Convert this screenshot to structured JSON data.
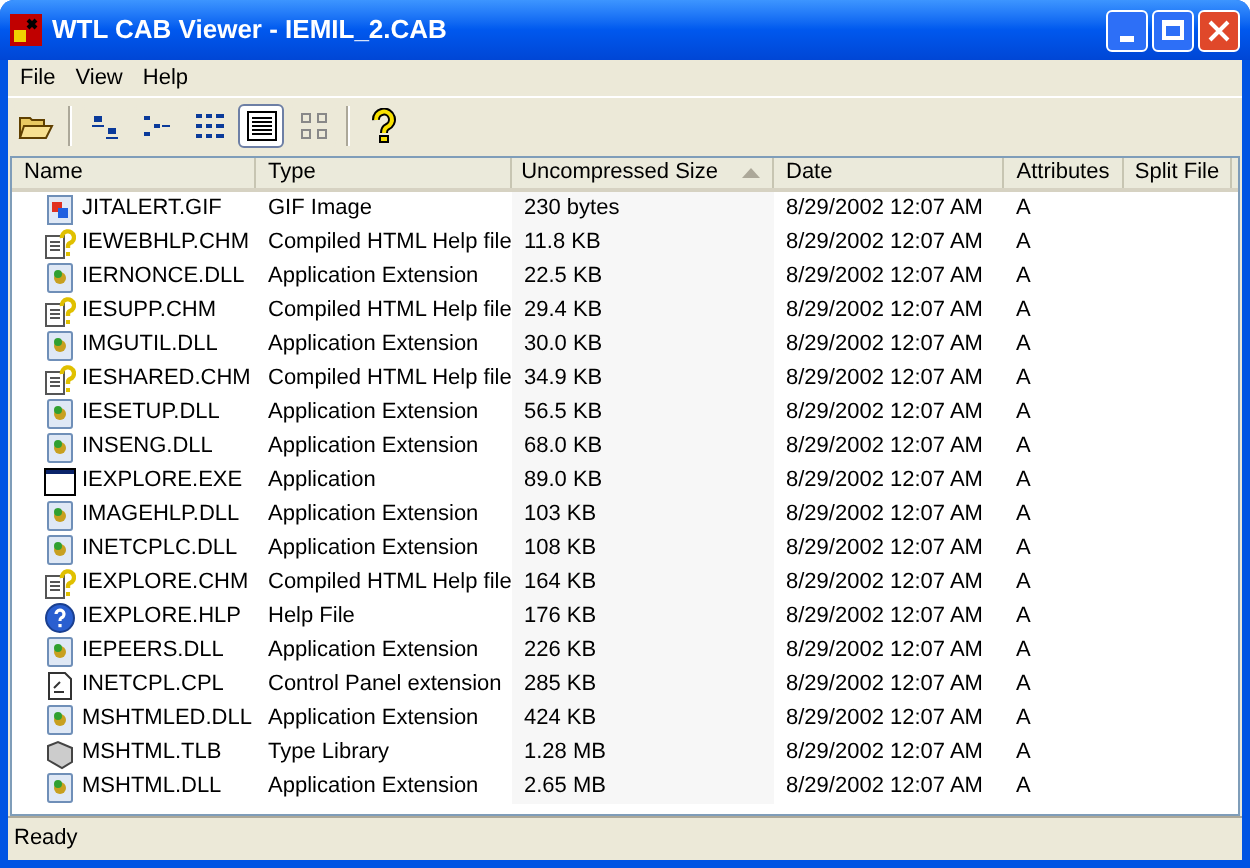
{
  "window": {
    "title": "WTL CAB Viewer - IEMIL_2.CAB"
  },
  "menu": [
    "File",
    "View",
    "Help"
  ],
  "toolbar": [
    {
      "kind": "open",
      "selected": false
    },
    {
      "kind": "sep"
    },
    {
      "kind": "large",
      "selected": false
    },
    {
      "kind": "small",
      "selected": false
    },
    {
      "kind": "list",
      "selected": false
    },
    {
      "kind": "details",
      "selected": true
    },
    {
      "kind": "thumbs",
      "selected": false
    },
    {
      "kind": "sep"
    },
    {
      "kind": "help",
      "selected": false
    }
  ],
  "table": {
    "columns": [
      {
        "label": "Name",
        "sorted": false
      },
      {
        "label": "Type",
        "sorted": false
      },
      {
        "label": "Uncompressed Size",
        "sorted": true
      },
      {
        "label": "Date",
        "sorted": false
      },
      {
        "label": "Attributes",
        "sorted": false
      },
      {
        "label": "Split File",
        "sorted": false
      }
    ],
    "rows": [
      {
        "kind": "gif",
        "name": "JITALERT.GIF",
        "type": "GIF Image",
        "size": "230 bytes",
        "date": "8/29/2002 12:07 AM",
        "attributes": "A"
      },
      {
        "kind": "chm",
        "name": "IEWEBHLP.CHM",
        "type": "Compiled HTML Help file",
        "size": "11.8 KB",
        "date": "8/29/2002 12:07 AM",
        "attributes": "A"
      },
      {
        "kind": "dll",
        "name": "IERNONCE.DLL",
        "type": "Application Extension",
        "size": "22.5 KB",
        "date": "8/29/2002 12:07 AM",
        "attributes": "A"
      },
      {
        "kind": "chm",
        "name": "IESUPP.CHM",
        "type": "Compiled HTML Help file",
        "size": "29.4 KB",
        "date": "8/29/2002 12:07 AM",
        "attributes": "A"
      },
      {
        "kind": "dll",
        "name": "IMGUTIL.DLL",
        "type": "Application Extension",
        "size": "30.0 KB",
        "date": "8/29/2002 12:07 AM",
        "attributes": "A"
      },
      {
        "kind": "chm",
        "name": "IESHARED.CHM",
        "type": "Compiled HTML Help file",
        "size": "34.9 KB",
        "date": "8/29/2002 12:07 AM",
        "attributes": "A"
      },
      {
        "kind": "dll",
        "name": "IESETUP.DLL",
        "type": "Application Extension",
        "size": "56.5 KB",
        "date": "8/29/2002 12:07 AM",
        "attributes": "A"
      },
      {
        "kind": "dll",
        "name": "INSENG.DLL",
        "type": "Application Extension",
        "size": "68.0 KB",
        "date": "8/29/2002 12:07 AM",
        "attributes": "A"
      },
      {
        "kind": "exe",
        "name": "IEXPLORE.EXE",
        "type": "Application",
        "size": "89.0 KB",
        "date": "8/29/2002 12:07 AM",
        "attributes": "A"
      },
      {
        "kind": "dll",
        "name": "IMAGEHLP.DLL",
        "type": "Application Extension",
        "size": "103 KB",
        "date": "8/29/2002 12:07 AM",
        "attributes": "A"
      },
      {
        "kind": "dll",
        "name": "INETCPLC.DLL",
        "type": "Application Extension",
        "size": "108 KB",
        "date": "8/29/2002 12:07 AM",
        "attributes": "A"
      },
      {
        "kind": "chm",
        "name": "IEXPLORE.CHM",
        "type": "Compiled HTML Help file",
        "size": "164 KB",
        "date": "8/29/2002 12:07 AM",
        "attributes": "A"
      },
      {
        "kind": "hlp",
        "name": "IEXPLORE.HLP",
        "type": "Help File",
        "size": "176 KB",
        "date": "8/29/2002 12:07 AM",
        "attributes": "A"
      },
      {
        "kind": "dll",
        "name": "IEPEERS.DLL",
        "type": "Application Extension",
        "size": "226 KB",
        "date": "8/29/2002 12:07 AM",
        "attributes": "A"
      },
      {
        "kind": "cpl",
        "name": "INETCPL.CPL",
        "type": "Control Panel extension",
        "size": "285 KB",
        "date": "8/29/2002 12:07 AM",
        "attributes": "A"
      },
      {
        "kind": "dll",
        "name": "MSHTMLED.DLL",
        "type": "Application Extension",
        "size": "424 KB",
        "date": "8/29/2002 12:07 AM",
        "attributes": "A"
      },
      {
        "kind": "tlb",
        "name": "MSHTML.TLB",
        "type": "Type Library",
        "size": "1.28 MB",
        "date": "8/29/2002 12:07 AM",
        "attributes": "A"
      },
      {
        "kind": "dll",
        "name": "MSHTML.DLL",
        "type": "Application Extension",
        "size": "2.65 MB",
        "date": "8/29/2002 12:07 AM",
        "attributes": "A"
      }
    ]
  },
  "status_bar": "Ready"
}
